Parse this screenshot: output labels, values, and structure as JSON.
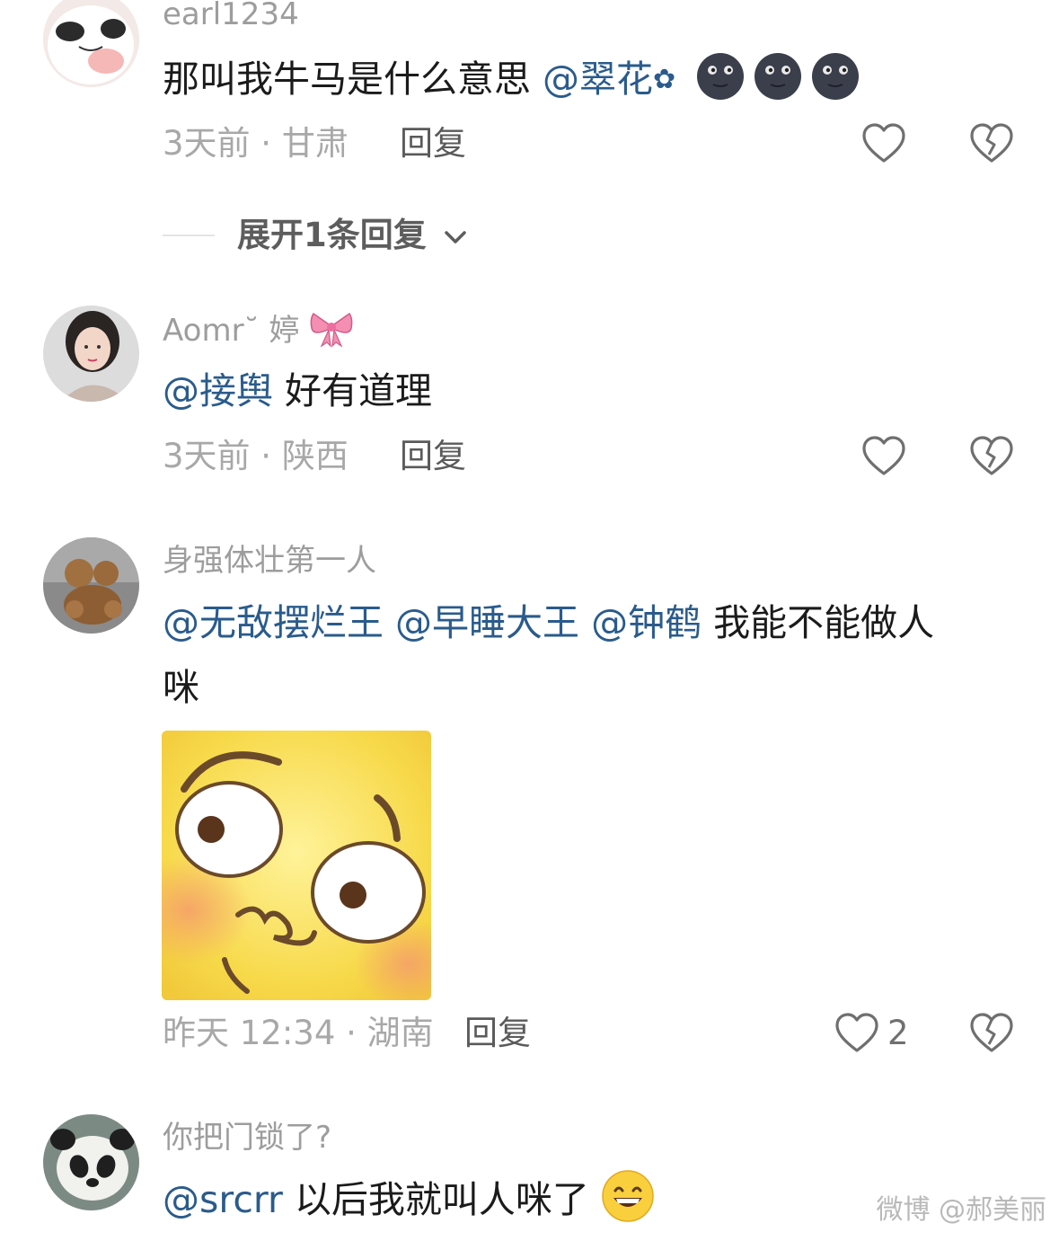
{
  "colors": {
    "mention": "#2a5b8c",
    "meta": "#a8a8a8",
    "username": "#9d9d9d",
    "body": "#1b1b1b"
  },
  "comments": [
    {
      "username": "earl1234",
      "text": "那叫我牛马是什么意思",
      "mentions": [
        "@翠花"
      ],
      "mention_suffix": "✿",
      "emojis": [
        "new-moon-face-icon",
        "new-moon-face-icon",
        "new-moon-face-icon"
      ],
      "meta": "3天前 · 甘肃",
      "reply_label": "回复",
      "expand_label": "展开1条回复"
    },
    {
      "username": "Aomr˘  婷",
      "username_emoji": "ribbon-icon",
      "mentions": [
        "@接舆"
      ],
      "text": "好有道理",
      "meta": "3天前 · 陕西",
      "reply_label": "回复"
    },
    {
      "username": "身强体壮第一人",
      "mentions": [
        "@无敌摆烂王",
        "@早睡大王",
        "@钟鹤"
      ],
      "text_line1": "我能不能做人",
      "text_line2": "咪",
      "sticker": "yellow-face-sticker",
      "meta": "昨天 12:34 · 湖南",
      "reply_label": "回复",
      "like_count": "2"
    },
    {
      "username": "你把门锁了?",
      "mentions": [
        "@srcrr"
      ],
      "text": "以后我就叫人咪了",
      "emoji": "grinning-sweat-face-icon"
    }
  ],
  "watermark": "微博 @郝美丽"
}
